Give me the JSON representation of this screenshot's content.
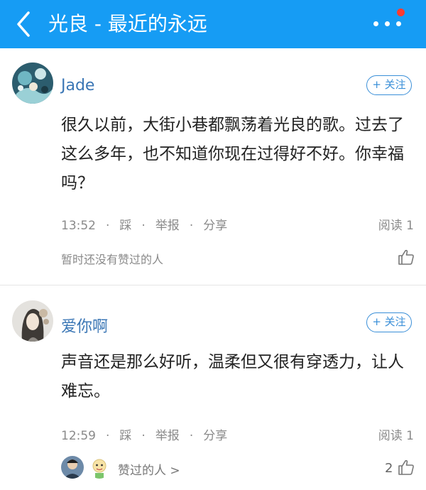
{
  "header": {
    "title": "光良 - 最近的永远",
    "bar_color": "#169cf4",
    "back_icon": "chevron-left-icon",
    "more_icon": "more-dots-icon"
  },
  "comments": [
    {
      "username": "Jade",
      "follow_label": "+ 关注",
      "text": "很久以前，大街小巷都飘荡着光良的歌。过去了这么多年，也不知道你现在过得好不好。你幸福吗？",
      "time": "13:52",
      "action_dislike": "踩",
      "action_report": "举报",
      "action_share": "分享",
      "reads": "阅读 1",
      "likes_status": "暂时还没有赞过的人",
      "like_count": ""
    },
    {
      "username": "爱你啊",
      "follow_label": "+ 关注",
      "text": "声音还是那么好听，温柔但又很有穿透力，让人难忘。",
      "time": "12:59",
      "action_dislike": "踩",
      "action_report": "举报",
      "action_share": "分享",
      "reads": "阅读 1",
      "likers_label": "赞过的人 >",
      "like_count": "2"
    }
  ]
}
